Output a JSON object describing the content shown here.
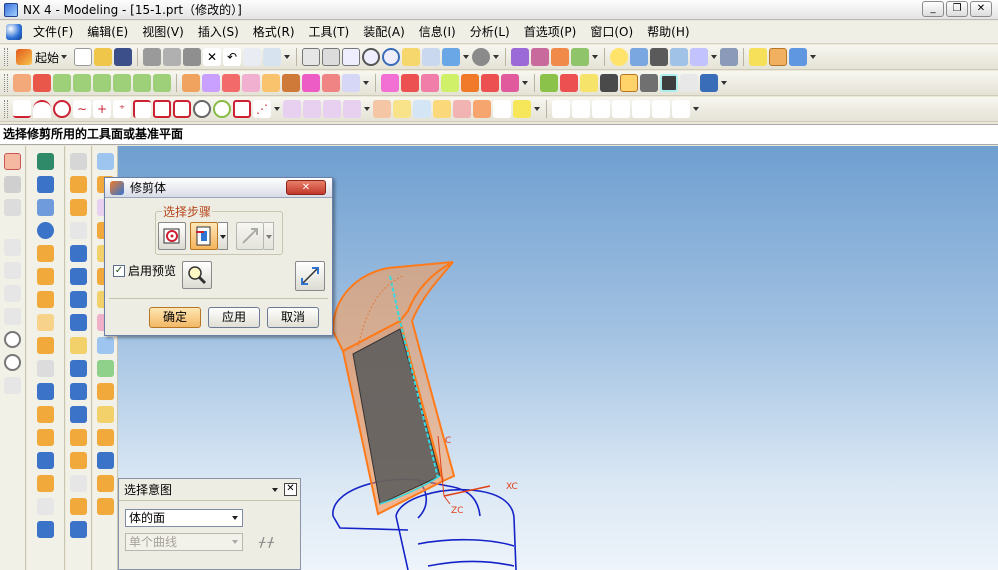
{
  "window": {
    "title": "NX 4 - Modeling - [15-1.prt（修改的）]",
    "controls": [
      "_",
      "❐",
      "✕"
    ]
  },
  "menu": {
    "items": [
      "文件(F)",
      "编辑(E)",
      "视图(V)",
      "插入(S)",
      "格式(R)",
      "工具(T)",
      "装配(A)",
      "信息(I)",
      "分析(L)",
      "首选项(P)",
      "窗口(O)",
      "帮助(H)"
    ]
  },
  "toolbar": {
    "start_label": "起始"
  },
  "prompt": {
    "text": "选择修剪所用的工具面或基准平面"
  },
  "trim_dialog": {
    "title": "修剪体",
    "close": "✕",
    "step_group_label": "选择步骤",
    "preview_checked": true,
    "preview_label": "启用预览",
    "ok_label": "确定",
    "apply_label": "应用",
    "cancel_label": "取消"
  },
  "selection_intent": {
    "title": "选择意图",
    "close": "✕",
    "face_rule": "体的面",
    "curve_rule": "单个曲线",
    "curve_rule_enabled": false
  },
  "viewport": {
    "axis_labels": {
      "xc": "XC",
      "zc": "ZC",
      "yc": "C"
    },
    "colors": {
      "body_orange": "#ff7a1a",
      "face_grey": "#5e5e5e",
      "wire_blue": "#1423c8",
      "edge_cyan": "#36d8e0",
      "axis_red": "#e0401a"
    }
  }
}
